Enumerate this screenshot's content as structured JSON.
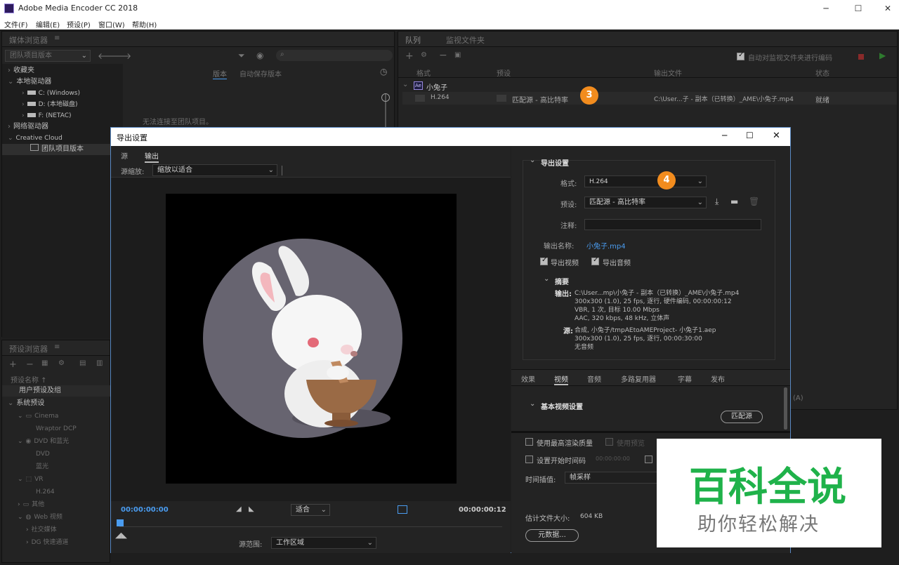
{
  "app": {
    "title": "Adobe Media Encoder CC 2018",
    "icon": "ame-app-icon"
  },
  "menu": [
    "文件(F)",
    "编辑(E)",
    "预设(P)",
    "窗口(W)",
    "帮助(H)"
  ],
  "media_browser": {
    "title": "媒体浏览器",
    "menu_glyph": "≡",
    "dropdown": "团队项目版本",
    "tree": [
      {
        "label": "收藏夹",
        "level": 0
      },
      {
        "label": "本地驱动器",
        "level": 0
      },
      {
        "label": "C: (Windows)",
        "level": 1
      },
      {
        "label": "D: (本地磁盘)",
        "level": 1
      },
      {
        "label": "F: (NETAC)",
        "level": 1
      },
      {
        "label": "网络驱动器",
        "level": 0
      },
      {
        "label": "Creative Cloud",
        "level": 0
      },
      {
        "label": "团队项目版本",
        "level": 2
      }
    ],
    "tabs": [
      "版本",
      "自动保存版本"
    ],
    "empty_msg": "无法连接至团队项目。"
  },
  "preset_browser": {
    "title": "预设浏览器",
    "menu_glyph": "≡",
    "col": "预设名称 ↑",
    "items": [
      "用户预设及组",
      "系统预设",
      "Cinema",
      "Wraptor DCP",
      "DVD 和蓝光",
      "DVD",
      "蓝光",
      "VR",
      "H.264",
      "其他",
      "Web 视频",
      "社交媒体",
      "DG 快速通道"
    ]
  },
  "queue": {
    "tabs": [
      "队列",
      "监视文件夹"
    ],
    "auto_encode": "自动对监视文件夹进行编码",
    "cols": [
      "格式",
      "预设",
      "输出文件",
      "状态"
    ],
    "job_name": "小兔子",
    "job_badge": "Ae",
    "row": {
      "format": "H.264",
      "preset": "匹配源 - 高比特率",
      "output": "C:\\User...子 - 副本（已转换）_AME\\小兔子.mp4",
      "status": "就绪"
    },
    "right_dropdown": "(A)"
  },
  "dialog": {
    "title": "导出设置",
    "tabs": [
      "源",
      "输出"
    ],
    "scale_label": "源缩放:",
    "scale_value": "缩放以适合",
    "tc_start": "00:00:00:00",
    "tc_end": "00:00:00:12",
    "fit": "适合",
    "range_label": "源范围:",
    "range_value": "工作区域",
    "export_settings": "导出设置",
    "format_label": "格式:",
    "format_value": "H.264",
    "preset_label": "预设:",
    "preset_value": "匹配源 - 高比特率",
    "comment_label": "注释:",
    "output_name_label": "输出名称:",
    "output_name_value": "小兔子.mp4",
    "export_video": "导出视频",
    "export_audio": "导出音频",
    "summary_title": "摘要",
    "summary_output_label": "输出:",
    "summary_output": [
      "C:\\User...mp\\小兔子 - 副本（已转换）_AME\\小兔子.mp4",
      "300x300 (1.0), 25 fps, 逐行, 硬件编码, 00:00:00:12",
      "VBR, 1 次, 目标 10.00 Mbps",
      "AAC, 320 kbps, 48 kHz, 立体声"
    ],
    "summary_source_label": "源:",
    "summary_source": [
      "合成, 小兔子/tmpAEtoAMEProject- 小兔子1.aep",
      "300x300 (1.0), 25 fps, 逐行, 00:00:30:00",
      "无音频"
    ],
    "lower_tabs": [
      "效果",
      "视频",
      "音频",
      "多路复用器",
      "字幕",
      "发布"
    ],
    "basic_video": "基本视频设置",
    "match_source": "匹配源",
    "max_quality": "使用最高渲染质量",
    "use_preview": "使用预览",
    "set_tc": "设置开始时间码",
    "tc_placeholder": "00:00:00:00",
    "interp_label": "时间插值:",
    "interp_value": "帧采样",
    "est_size": "估计文件大小:",
    "est_value": "604 KB",
    "metadata": "元数据..."
  },
  "badges": [
    "3",
    "4"
  ],
  "watermark": {
    "big": "百科全说",
    "small": "助你轻松解决",
    "color": "#1fb24a"
  }
}
